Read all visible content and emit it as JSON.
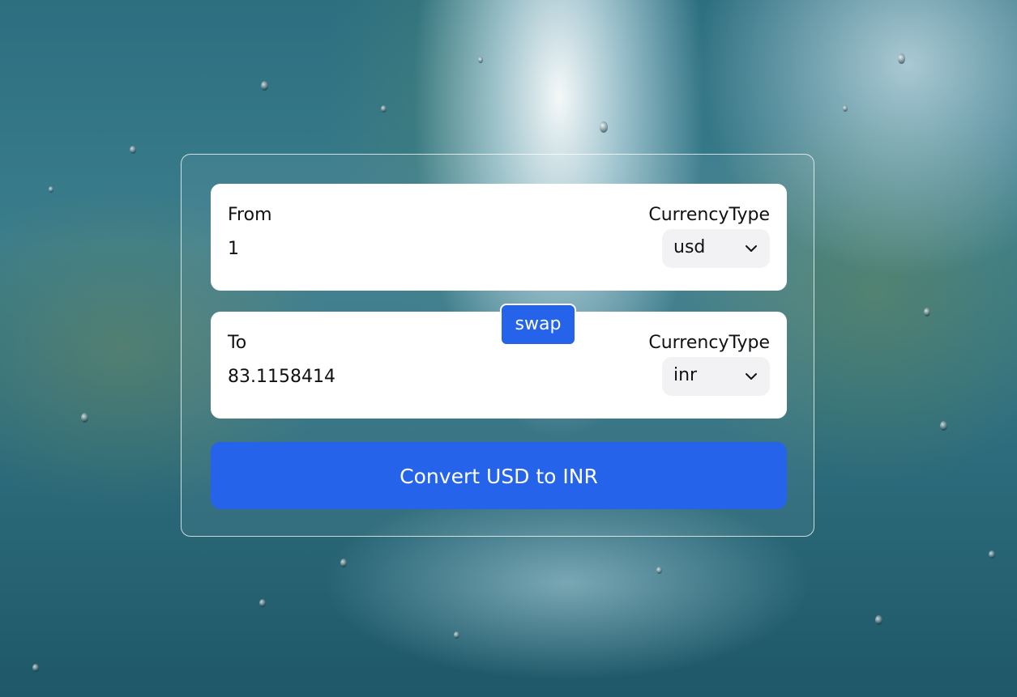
{
  "from_panel": {
    "label": "From",
    "amount": "1",
    "currency_type_label": "CurrencyType",
    "currency": "usd"
  },
  "to_panel": {
    "label": "To",
    "amount": "83.1158414",
    "currency_type_label": "CurrencyType",
    "currency": "inr"
  },
  "swap_label": "swap",
  "convert_label": "Convert USD to INR",
  "colors": {
    "accent": "#2563eb",
    "panel": "#ffffff",
    "select_bg": "#f2f2f4"
  },
  "icons": {
    "select_chevron": "chevron-down-icon",
    "background": "rainy-window-photo"
  }
}
